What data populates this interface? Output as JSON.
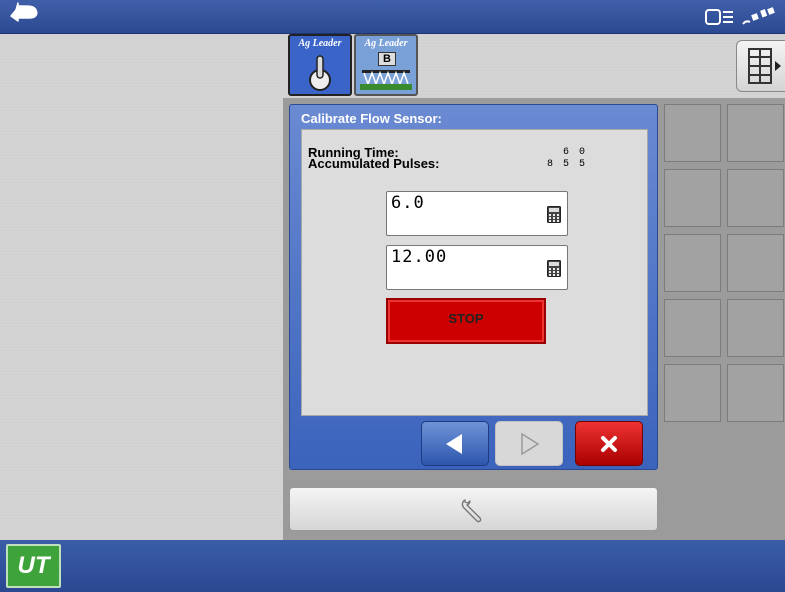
{
  "tabs": [
    {
      "brand": "Ag Leader"
    },
    {
      "brand": "Ag Leader",
      "label": "B"
    }
  ],
  "dialog": {
    "title": "Calibrate Flow Sensor:",
    "running_time_label": "Running Time:",
    "running_time_value": "6 0",
    "pulses_label": "Accumulated Pulses:",
    "pulses_value": "8 5 5",
    "field1_value": "6.0",
    "field2_value": "12.00",
    "stop_label": "STOP"
  },
  "bottom": {
    "logo_text": "UT"
  },
  "icons": {
    "back": "back-arrow-icon",
    "implement": "implement-status-icon",
    "gps": "gps-satellite-icon",
    "layout": "layout-grid-icon",
    "calculator": "calculator-icon",
    "prev": "left-arrow-icon",
    "next": "right-arrow-icon",
    "cancel": "close-x-icon",
    "wrench": "wrench-icon"
  },
  "colors": {
    "topbar": "#3f5fa8",
    "active_tab": "#3a64c8",
    "stop_button": "#cc0000",
    "cancel_button": "#cc1a1a",
    "ut_logo": "#3ea33a"
  }
}
